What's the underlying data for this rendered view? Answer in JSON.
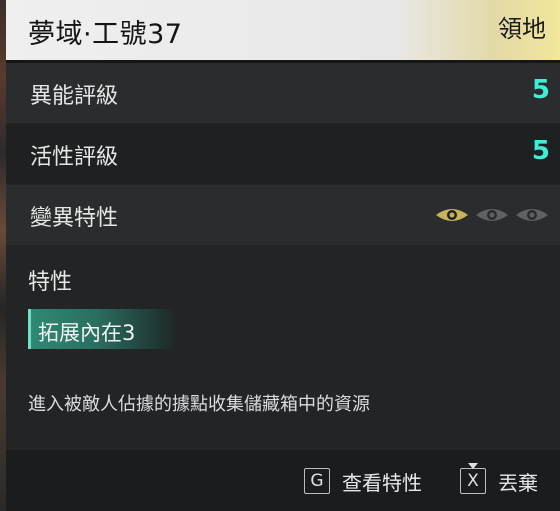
{
  "header": {
    "title": "夢域·工號37",
    "category": "領地",
    "accent_color": "#f2e79a"
  },
  "stats": [
    {
      "label": "異能評級",
      "value": "5"
    },
    {
      "label": "活性評級",
      "value": "5"
    }
  ],
  "mutation": {
    "label": "變異特性",
    "eyes_active": 1,
    "eyes_total": 3,
    "active_color": "#c8b35a",
    "inactive_color": "#6a6c6d"
  },
  "traits": {
    "title": "特性",
    "items": [
      "拓展內在3"
    ]
  },
  "description": "進入被敵人佔據的據點收集儲藏箱中的資源",
  "footer": {
    "actions": [
      {
        "key": "G",
        "label": "查看特性",
        "icon": "g-key-icon"
      },
      {
        "key": "X",
        "label": "丟棄",
        "icon": "x-key-icon"
      }
    ]
  },
  "colors": {
    "stat_value": "#3cf0d8",
    "trait_tag": "#2f8a74"
  }
}
